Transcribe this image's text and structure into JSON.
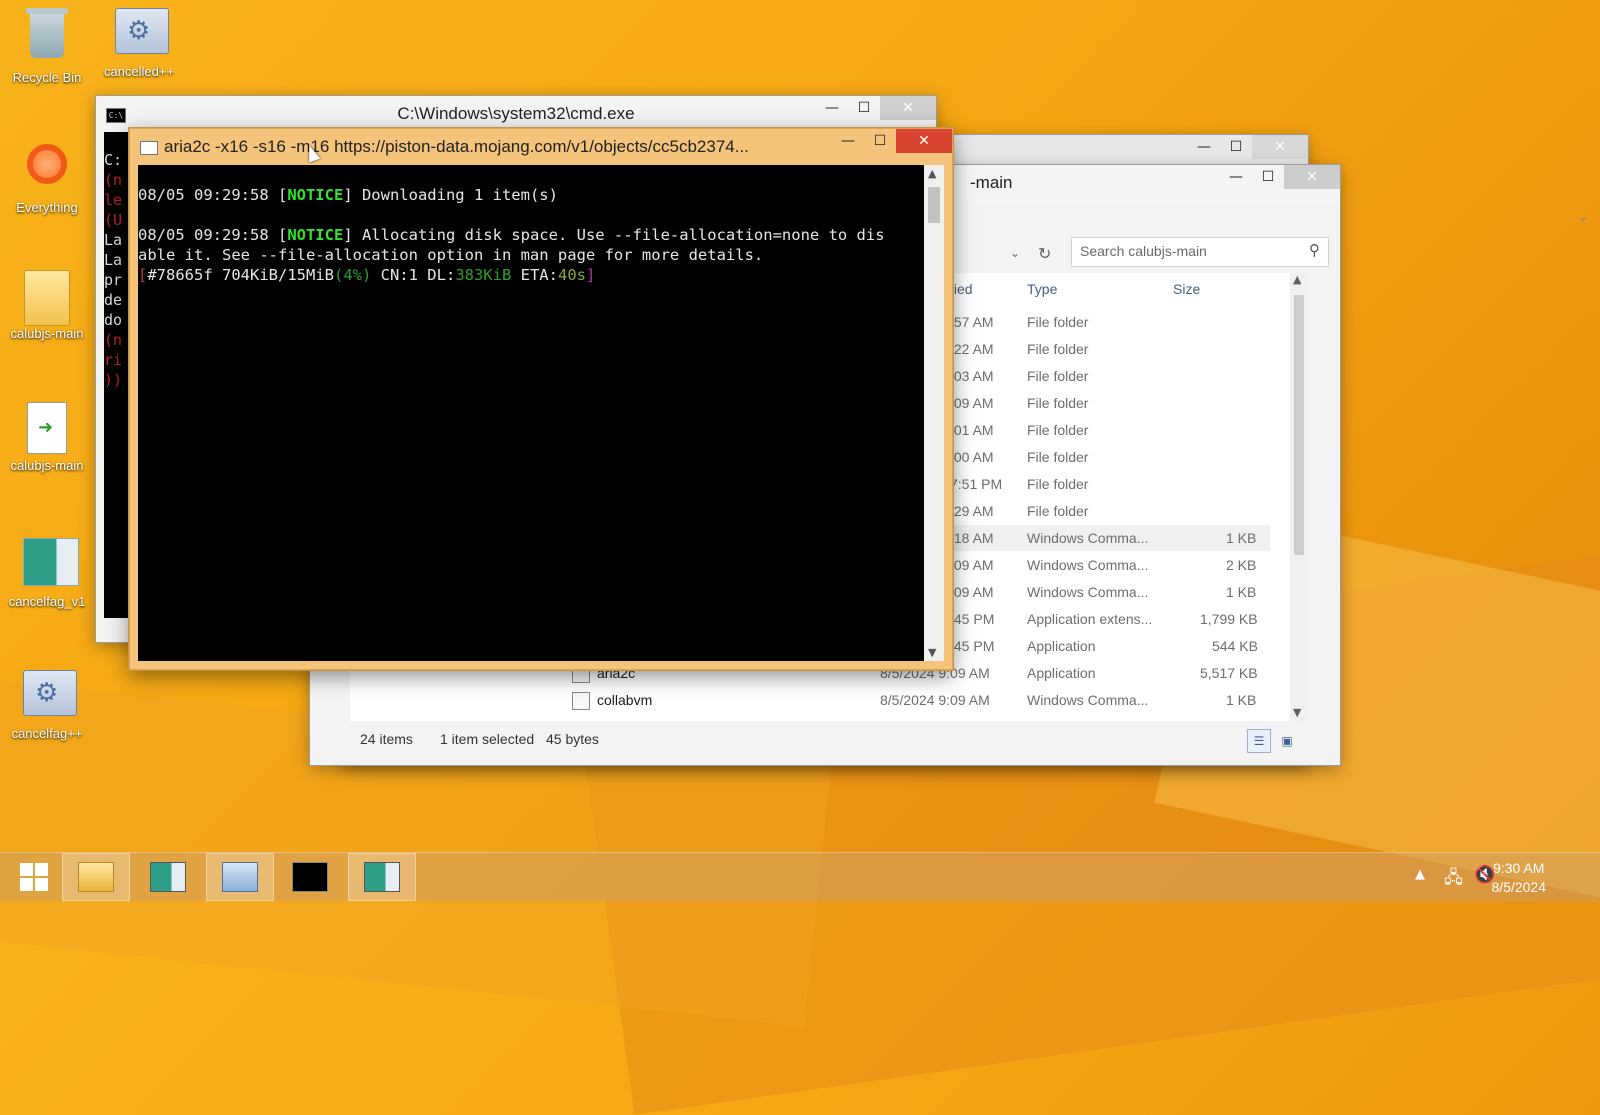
{
  "desktop": {
    "icons": [
      {
        "label": "Recycle Bin",
        "icon": "recycle-bin-icon"
      },
      {
        "label": "cancelled++",
        "icon": "gears-icon"
      },
      {
        "label": "Everything",
        "icon": "everything-search-icon"
      },
      {
        "label": "calubjs-main",
        "icon": "folder-zip-icon"
      },
      {
        "label": "calubjs-main",
        "icon": "script-file-icon"
      },
      {
        "label": "cancelfag_v1",
        "icon": "app-window-icon"
      },
      {
        "label": "cancelfag++",
        "icon": "gears-icon"
      }
    ]
  },
  "cmd": {
    "title": "C:\\Windows\\system32\\cmd.exe",
    "icon_text": "C:\\",
    "console_lines": [
      "C:",
      "(n",
      "le",
      "(U",
      "La",
      "La",
      "pr",
      "",
      "de",
      "do",
      "(n",
      "ri",
      "))"
    ]
  },
  "aria": {
    "title": "aria2c  -x16 -s16 -m16 https://piston-data.mojang.com/v1/objects/cc5cb2374...",
    "line1_time": "08/05 09:29:58 [",
    "line1_tag": "NOTICE",
    "line1_rest": "] Downloading 1 item(s)",
    "line2_time": "08/05 09:29:58 [",
    "line2_tag": "NOTICE",
    "line2_rest": "] Allocating disk space. Use --file-allocation=none to dis",
    "line3": "able it. See --file-allocation option in man page for more details.",
    "progress": {
      "open": "[",
      "gid_size": "#78665f 704KiB/15MiB",
      "pct": "(4%)",
      "cn": " CN:1 DL:",
      "dl": "383KiB",
      "eta_label": " ETA:",
      "eta": "40s",
      "close": "]"
    }
  },
  "explorer": {
    "title_partial": "-main",
    "search_placeholder": "Search calubjs-main",
    "columns": {
      "modified": "fied",
      "type": "Type",
      "size": "Size"
    },
    "rows": [
      {
        "name": "",
        "modified": ":57 AM",
        "type": "File folder",
        "size": ""
      },
      {
        "name": "",
        "modified": ":22 AM",
        "type": "File folder",
        "size": ""
      },
      {
        "name": "",
        "modified": ":03 AM",
        "type": "File folder",
        "size": ""
      },
      {
        "name": "",
        "modified": ":09 AM",
        "type": "File folder",
        "size": ""
      },
      {
        "name": "",
        "modified": ":01 AM",
        "type": "File folder",
        "size": ""
      },
      {
        "name": "",
        "modified": ":00 AM",
        "type": "File folder",
        "size": ""
      },
      {
        "name": "",
        "modified": "7:51 PM",
        "type": "File folder",
        "size": ""
      },
      {
        "name": "",
        "modified": ":29 AM",
        "type": "File folder",
        "size": ""
      },
      {
        "name": "",
        "modified": ":18 AM",
        "type": "Windows Comma...",
        "size": "1 KB",
        "selected": true
      },
      {
        "name": "",
        "modified": ":09 AM",
        "type": "Windows Comma...",
        "size": "2 KB"
      },
      {
        "name": "",
        "modified": ":09 AM",
        "type": "Windows Comma...",
        "size": "1 KB"
      },
      {
        "name": "",
        "modified": ":45 PM",
        "type": "Application extens...",
        "size": "1,799 KB"
      },
      {
        "name": "",
        "modified": ":45 PM",
        "type": "Application",
        "size": "544 KB"
      },
      {
        "name": "aria2c",
        "modified": "8/5/2024 9:09 AM",
        "type": "Application",
        "size": "5,517 KB"
      },
      {
        "name": "collabvm",
        "modified": "8/5/2024 9:09 AM",
        "type": "Windows Comma...",
        "size": "1 KB"
      }
    ],
    "status": {
      "items": "24 items",
      "selected": "1 item selected",
      "bytes": "45 bytes"
    }
  },
  "taskbar": {
    "items": [
      "start-button",
      "file-explorer",
      "app-window",
      "control-panel",
      "cmd",
      "aria2c-window"
    ],
    "time": "9:30 AM",
    "date": "8/5/2024"
  }
}
